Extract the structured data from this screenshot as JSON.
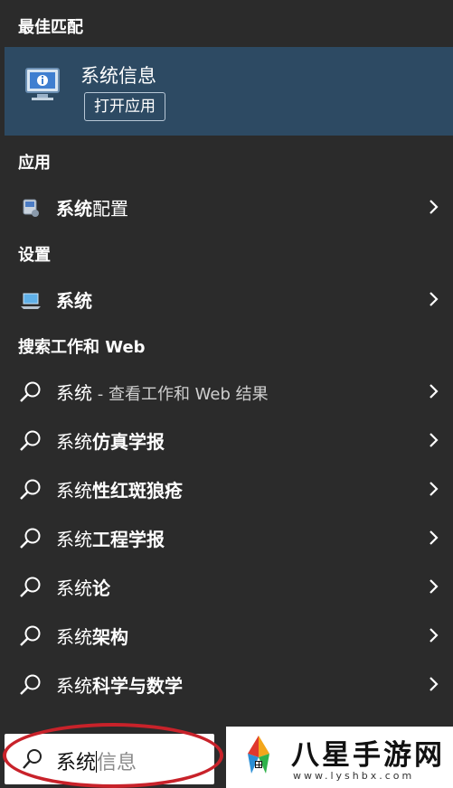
{
  "best_match": {
    "header": "最佳匹配",
    "title": "系统信息",
    "open_button": "打开应用"
  },
  "apps": {
    "header": "应用",
    "items": [
      {
        "bold": "系统",
        "rest": "配置",
        "icon": "system-config-icon"
      }
    ]
  },
  "settings": {
    "header": "设置",
    "items": [
      {
        "bold": "系统",
        "rest": "",
        "icon": "laptop-settings-icon"
      }
    ]
  },
  "web": {
    "header": "搜索工作和 Web",
    "items": [
      {
        "plain": "系统",
        "dim": " - 查看工作和 Web 结果",
        "bold": ""
      },
      {
        "plain": "系统",
        "bold": "仿真学报",
        "dim": ""
      },
      {
        "plain": "系统",
        "bold": "性红斑狼疮",
        "dim": ""
      },
      {
        "plain": "系统",
        "bold": "工程学报",
        "dim": ""
      },
      {
        "plain": "系统",
        "bold": "论",
        "dim": ""
      },
      {
        "plain": "系统",
        "bold": "架构",
        "dim": ""
      },
      {
        "plain": "系统",
        "bold": "科学与数学",
        "dim": ""
      }
    ]
  },
  "search": {
    "typed": "系统",
    "suggestion": "信息"
  },
  "watermark": {
    "title": "八星手游网",
    "url": "www.lyshbx.com"
  },
  "colors": {
    "background": "#2b2b2b",
    "best_match_bg": "#2d4a63",
    "annotation_red": "#c8222a"
  }
}
